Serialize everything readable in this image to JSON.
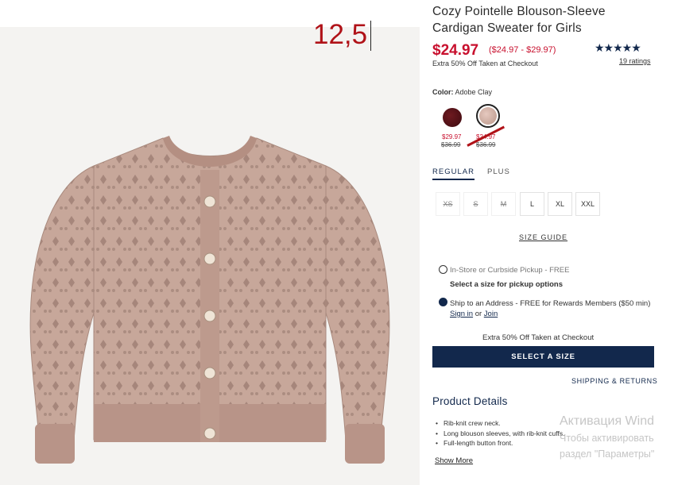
{
  "product": {
    "title": "Cozy Pointelle Blouson-Sleeve Cardigan Sweater for Girls",
    "price": "$24.97",
    "price_range": "($24.97 - $29.97)",
    "discount_note": "Extra 50% Off Taken at Checkout",
    "rating_stars": "★★★★★",
    "rating_value": 4.7,
    "ratings_link": "19 ratings"
  },
  "annotation": {
    "text": "12,5"
  },
  "color": {
    "label": "Color:",
    "selected": "Adobe Clay",
    "swatches": [
      {
        "sale": "$29.97",
        "original": "$36.99",
        "color": "#5a1218"
      },
      {
        "sale": "$24.97",
        "original": "$36.99",
        "color": "#d8b8ad"
      }
    ]
  },
  "fit_tabs": {
    "regular": "REGULAR",
    "plus": "PLUS"
  },
  "sizes": [
    "XS",
    "S",
    "M",
    "L",
    "XL",
    "XXL"
  ],
  "size_guide": "SIZE GUIDE",
  "fulfillment": {
    "pickup_label": "In-Store or Curbside Pickup - FREE",
    "pickup_note": "Select a size for pickup options",
    "ship_label": "Ship to an Address - FREE for Rewards Members ($50 min)",
    "sign_in": "Sign in",
    "or": "or",
    "join": "Join"
  },
  "checkout_note": "Extra 50% Off Taken at Checkout",
  "cta_label": "SELECT A SIZE",
  "shipping_link": "SHIPPING & RETURNS",
  "details": {
    "title": "Product Details",
    "bullets": [
      "Rib-knit crew neck.",
      "Long blouson sleeves, with rib-knit cuffs.",
      "Full-length button front."
    ],
    "show_more": "Show More"
  },
  "watermark": {
    "line1": "Активация Wind",
    "line2": "Чтобы активировать",
    "line3": "раздел \"Параметры\""
  },
  "colors": {
    "navy": "#12284c",
    "sale_red": "#c8102e",
    "annotation_red": "#b01218"
  }
}
